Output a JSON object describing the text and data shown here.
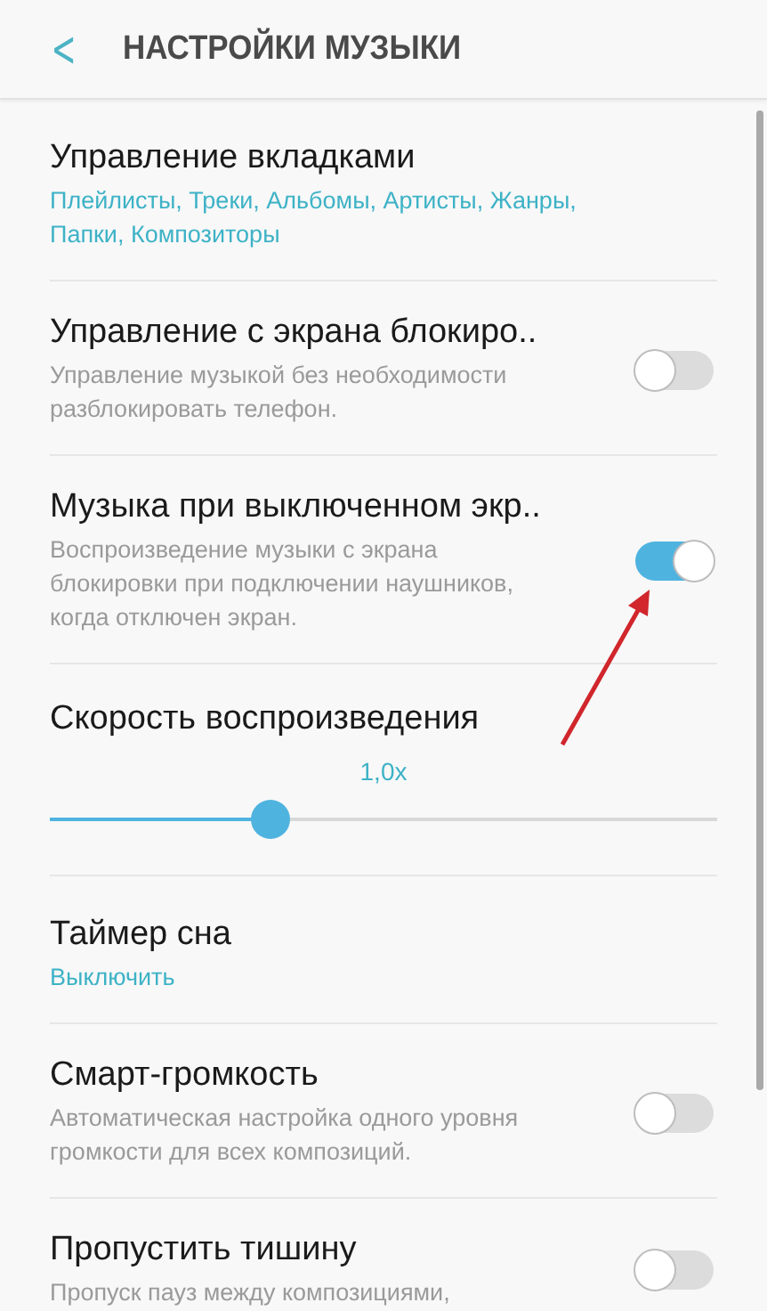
{
  "header": {
    "back": "<",
    "title": "НАСТРОЙКИ МУЗЫКИ"
  },
  "items": [
    {
      "kind": "link",
      "title": "Управление вкладками",
      "subtitle": "Плейлисты, Треки, Альбомы, Артисты, Жанры, Папки, Композиторы"
    },
    {
      "kind": "toggle",
      "title": "Управление с экрана блокиро..",
      "subtitle": "Управление музыкой без необходимости разблокировать телефон.",
      "on": false
    },
    {
      "kind": "toggle",
      "title": "Музыка при выключенном экр..",
      "subtitle": "Воспроизведение музыки с экрана блокировки при подключении наушников, когда отключен экран.",
      "on": true
    },
    {
      "kind": "slider",
      "title": "Скорость воспроизведения",
      "reading": "1,0x",
      "level": 0.33
    },
    {
      "kind": "link",
      "title": "Таймер сна",
      "subtitle": "Выключить"
    },
    {
      "kind": "toggle",
      "title": "Смарт-громкость",
      "subtitle": "Автоматическая настройка одного уровня громкости для всех композиций.",
      "on": false
    },
    {
      "kind": "toggle",
      "title": "Пропустить тишину",
      "subtitle": "Пропуск пауз между композициями,",
      "on": false
    }
  ]
}
